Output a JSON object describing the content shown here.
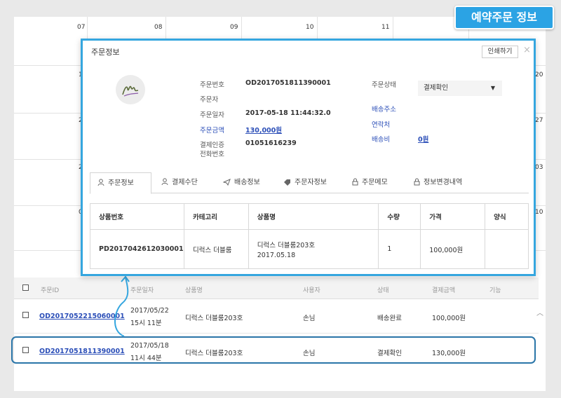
{
  "badge_title": "예약주문 정보",
  "calendar": {
    "dates_top": [
      "07",
      "08",
      "09",
      "10",
      "11"
    ],
    "right_edge_dates": [
      "20",
      "27",
      "03",
      "10"
    ],
    "left_edge_partial": [
      "1",
      "2",
      "2",
      "0"
    ]
  },
  "modal": {
    "title": "주문정보",
    "print_label": "인쇄하기",
    "close_label": "×",
    "order_no_label": "주문번호",
    "order_no_value": "OD2017051811390001",
    "orderer_label": "주문자",
    "order_date_label": "주문일자",
    "order_date_value": "2017-05-18 11:44:32.0",
    "amount_label": "주문금액",
    "amount_value": "130,000원",
    "auth_phone_label_1": "결제인증",
    "auth_phone_label_2": "전화번호",
    "auth_phone_value": "01051616239",
    "status_label": "주문상태",
    "status_value": "결제확인",
    "ship_addr_label": "배송주소",
    "contact_label": "연락처",
    "ship_fee_label": "배송비",
    "ship_fee_value": "0원",
    "tabs": [
      "주문정보",
      "결제수단",
      "배송정보",
      "주문자정보",
      "주문메모",
      "정보변경내역"
    ],
    "table_headers": [
      "상품번호",
      "카테고리",
      "상품명",
      "수량",
      "가격",
      "양식"
    ],
    "table_row": {
      "product_no": "PD2017042612030001",
      "category": "디럭스 더블룸",
      "name_line1": "디럭스 더블룸203호",
      "name_line2": "2017.05.18",
      "qty": "1",
      "price": "100,000원",
      "form": ""
    }
  },
  "list": {
    "headers": [
      "주문ID",
      "주문일자",
      "상품명",
      "사용자",
      "상태",
      "결제금액",
      "기능"
    ],
    "rows": [
      {
        "id": "OD2017052215060001",
        "date1": "2017/05/22",
        "date2": "15시 11분",
        "product": "디럭스 더블룸203호",
        "user": "손님",
        "status": "배송완료",
        "amount": "100,000원"
      },
      {
        "id": "OD2017051811390001",
        "date1": "2017/05/18",
        "date2": "11시 44분",
        "product": "디럭스 더블룸203호",
        "user": "손님",
        "status": "결제확인",
        "amount": "130,000원"
      }
    ]
  },
  "colors": {
    "accent": "#2ba3e4",
    "modal_border": "#35a6df",
    "link": "#2c4fb8",
    "highlight": "#2a75a8"
  }
}
